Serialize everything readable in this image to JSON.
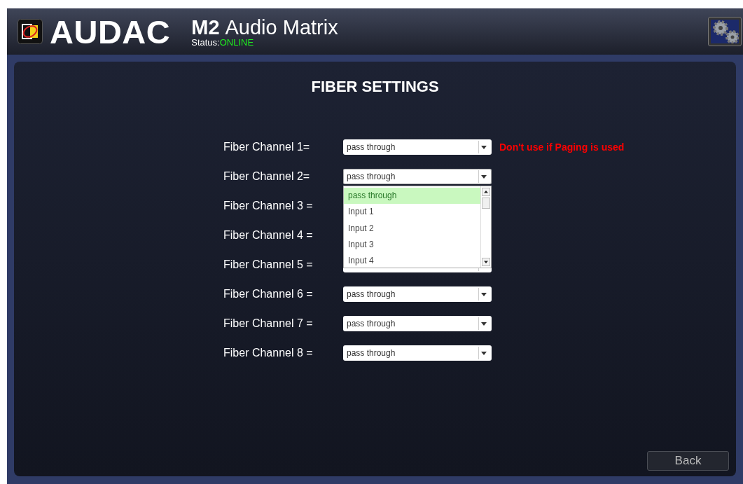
{
  "header": {
    "brand": "AUDAC",
    "model": "M2",
    "product": "Audio Matrix",
    "status_label": "Status:",
    "status_value": "ONLINE"
  },
  "title": "FIBER SETTINGS",
  "channels": [
    {
      "label": "Fiber Channel 1=",
      "value": "pass through",
      "warning": "Don't use if Paging is used",
      "expanded": false
    },
    {
      "label": "Fiber Channel 2=",
      "value": "pass through",
      "expanded": true,
      "options": [
        {
          "label": "pass through",
          "selected": true
        },
        {
          "label": "Input 1",
          "selected": false
        },
        {
          "label": "Input 2",
          "selected": false
        },
        {
          "label": "Input 3",
          "selected": false
        },
        {
          "label": "Input 4",
          "selected": false
        }
      ]
    },
    {
      "label": "Fiber Channel 3 =",
      "expanded": false
    },
    {
      "label": "Fiber Channel 4 =",
      "expanded": false
    },
    {
      "label": "Fiber Channel 5 =",
      "expanded": false
    },
    {
      "label": "Fiber Channel 6 =",
      "value": "pass through",
      "expanded": false
    },
    {
      "label": "Fiber Channel 7 =",
      "value": "pass through",
      "expanded": false
    },
    {
      "label": "Fiber Channel 8 =",
      "value": "pass through",
      "expanded": false
    }
  ],
  "back_button": "Back"
}
